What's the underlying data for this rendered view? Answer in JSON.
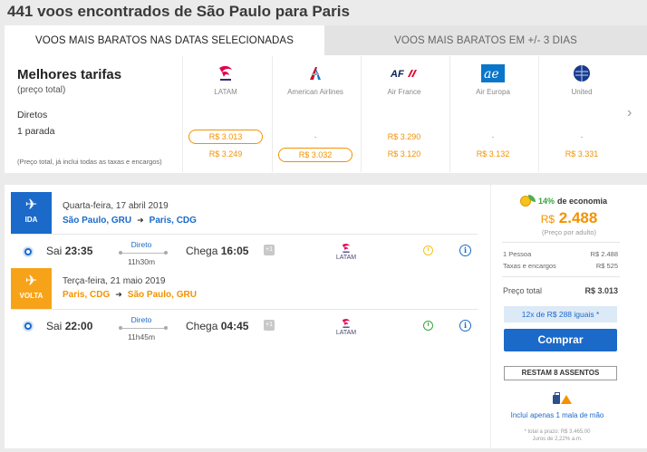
{
  "heading": "441 voos encontrados de São Paulo para Paris",
  "tabs": [
    {
      "label": "VOOS MAIS BARATOS NAS DATAS SELECIONADAS",
      "active": true
    },
    {
      "label": "VOOS MAIS BARATOS EM +/- 3 DIAS",
      "active": false
    }
  ],
  "fares": {
    "title": "Melhores tarifas",
    "subtitle": "(preço total)",
    "row_direct": "Diretos",
    "row_one_stop": "1 parada",
    "note": "(Preço total, já inclui todas as taxas e encargos)",
    "airlines": [
      {
        "name": "LATAM",
        "logo": "latam-logo",
        "direct": "R$ 3.013",
        "one_stop": "R$ 3.249",
        "highlight": "direct"
      },
      {
        "name": "American Airlines",
        "logo": "american-airlines-logo",
        "direct": "-",
        "one_stop": "R$ 3.032",
        "highlight": "one_stop"
      },
      {
        "name": "Air France",
        "logo": "air-france-logo",
        "direct": "R$ 3.290",
        "one_stop": "R$ 3.120",
        "highlight": ""
      },
      {
        "name": "Air Europa",
        "logo": "air-europa-logo",
        "direct": "-",
        "one_stop": "R$ 3.132",
        "highlight": ""
      },
      {
        "name": "United",
        "logo": "united-logo",
        "direct": "-",
        "one_stop": "R$ 3.331",
        "highlight": ""
      }
    ]
  },
  "flight": {
    "outbound": {
      "badge": "IDA",
      "date": "Quarta-feira, 17 abril 2019",
      "from": "São Paulo, GRU",
      "to": "Paris, CDG",
      "depart_prefix": "Sai",
      "depart_time": "23:35",
      "type": "Direto",
      "duration": "11h30m",
      "arrive_prefix": "Chega",
      "arrive_time": "16:05",
      "day_offset": "+1",
      "airline": "LATAM",
      "clock_color": "#f6c31a"
    },
    "return": {
      "badge": "VOLTA",
      "date": "Terça-feira, 21 maio 2019",
      "from": "Paris, CDG",
      "to": "São Paulo, GRU",
      "depart_prefix": "Sai",
      "depart_time": "22:00",
      "type": "Direto",
      "duration": "11h45m",
      "arrive_prefix": "Chega",
      "arrive_time": "04:45",
      "day_offset": "+1",
      "airline": "LATAM",
      "clock_color": "#35a53c"
    }
  },
  "price": {
    "economy_pct": "14%",
    "economy_label": "de economia",
    "currency": "R$",
    "amount": "2.488",
    "per_adult": "(Preço por adulto)",
    "one_person_label": "1 Pessoa",
    "one_person_value": "R$ 2.488",
    "fees_label": "Taxas e encargos",
    "fees_value": "R$ 525",
    "total_label": "Preço total",
    "total_value": "R$ 3.013",
    "installments": "12x de R$ 288 iguais *",
    "buy": "Comprar",
    "seats": "RESTAM 8 ASSENTOS",
    "baggage": "Incluí apenas 1 mala de mão",
    "fine_1": "* total a prazo: R$ 3.465,00",
    "fine_2": "Juros de 2,22% a.m."
  },
  "colors": {
    "primary": "#1b6ac9",
    "accent": "#f39200",
    "return_badge": "#f6a31a",
    "economy": "#35a53c"
  }
}
